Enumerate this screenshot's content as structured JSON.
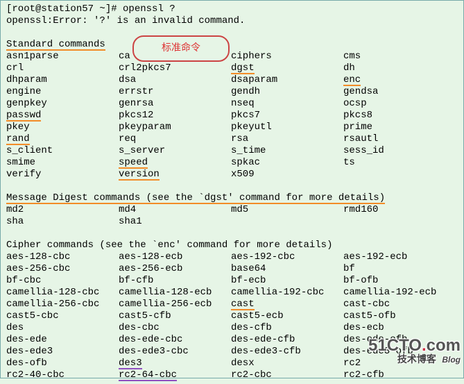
{
  "prompt": "[root@station57 ~]# ",
  "command": "openssl ?",
  "error_line": "openssl:Error: '?' is an invalid command.",
  "callout_text": "标准命令",
  "sections": {
    "standard": {
      "header": "Standard commands",
      "rows": [
        [
          "asn1parse",
          "ca",
          "ciphers",
          "cms"
        ],
        [
          "crl",
          "crl2pkcs7",
          "dgst",
          "dh"
        ],
        [
          "dhparam",
          "dsa",
          "dsaparam",
          "enc"
        ],
        [
          "engine",
          "errstr",
          "gendh",
          "gendsa"
        ],
        [
          "genpkey",
          "genrsa",
          "nseq",
          "ocsp"
        ],
        [
          "passwd",
          "pkcs12",
          "pkcs7",
          "pkcs8"
        ],
        [
          "pkey",
          "pkeyparam",
          "pkeyutl",
          "prime"
        ],
        [
          "rand",
          "req",
          "rsa",
          "rsautl"
        ],
        [
          "s_client",
          "s_server",
          "s_time",
          "sess_id"
        ],
        [
          "smime",
          "speed",
          "spkac",
          "ts"
        ],
        [
          "verify",
          "version",
          "x509",
          ""
        ]
      ],
      "orange_underlines": [
        "Standard commands",
        "dgst",
        "enc",
        "passwd",
        "rand",
        "speed",
        "version"
      ]
    },
    "digest": {
      "header": "Message Digest commands (see the `dgst' command for more details)",
      "rows": [
        [
          "md2",
          "md4",
          "md5",
          "rmd160"
        ],
        [
          "sha",
          "sha1",
          "",
          ""
        ]
      ],
      "orange_underlines": [
        "Message Digest commands (see the `dgst' command for more details)"
      ]
    },
    "cipher": {
      "header": "Cipher commands (see the `enc' command for more details)",
      "rows": [
        [
          "aes-128-cbc",
          "aes-128-ecb",
          "aes-192-cbc",
          "aes-192-ecb"
        ],
        [
          "aes-256-cbc",
          "aes-256-ecb",
          "base64",
          "bf"
        ],
        [
          "bf-cbc",
          "bf-cfb",
          "bf-ecb",
          "bf-ofb"
        ],
        [
          "camellia-128-cbc",
          "camellia-128-ecb",
          "camellia-192-cbc",
          "camellia-192-ecb"
        ],
        [
          "camellia-256-cbc",
          "camellia-256-ecb",
          "cast",
          "cast-cbc"
        ],
        [
          "cast5-cbc",
          "cast5-cfb",
          "cast5-ecb",
          "cast5-ofb"
        ],
        [
          "des",
          "des-cbc",
          "des-cfb",
          "des-ecb"
        ],
        [
          "des-ede",
          "des-ede-cbc",
          "des-ede-cfb",
          "des-ede-ofb"
        ],
        [
          "des-ede3",
          "des-ede3-cbc",
          "des-ede3-cfb",
          "des-ede3-ofb"
        ],
        [
          "des-ofb",
          "des3",
          "desx",
          "rc2"
        ],
        [
          "rc2-40-cbc",
          "rc2-64-cbc",
          "rc2-cbc",
          "rc2-cfb"
        ]
      ],
      "orange_underlines": [
        "cast"
      ],
      "purple_underlines": [
        "des3",
        "rc2-64-cbc"
      ]
    }
  },
  "watermark": {
    "main": "51CTO",
    "dot": ".",
    "suffix": "com",
    "sub1": "技术博客",
    "sub2": "Blog"
  }
}
